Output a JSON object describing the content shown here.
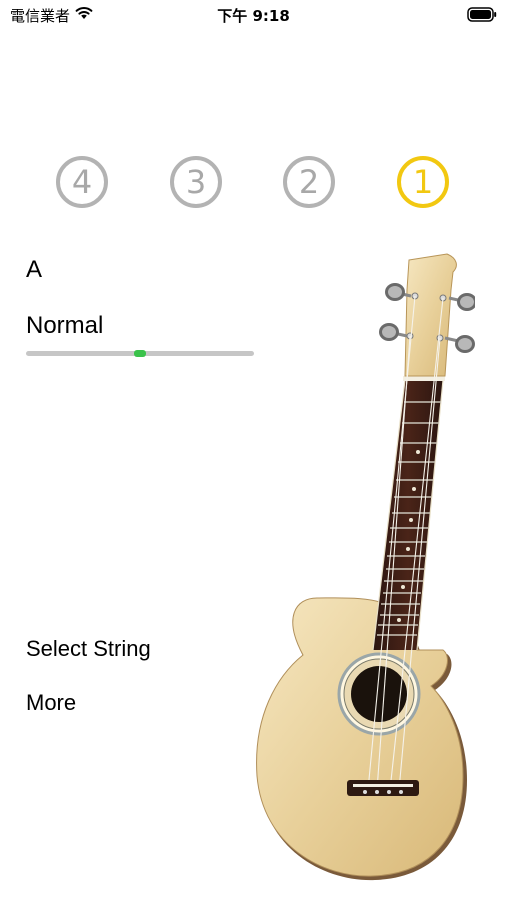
{
  "status_bar": {
    "carrier": "電信業者",
    "time": "下午 9:18"
  },
  "strings": [
    {
      "label": "4",
      "active": false
    },
    {
      "label": "3",
      "active": false
    },
    {
      "label": "2",
      "active": false
    },
    {
      "label": "1",
      "active": true
    }
  ],
  "tuner": {
    "note": "A",
    "status": "Normal",
    "meter_position": 0.5
  },
  "menu": {
    "select_string": "Select String",
    "more": "More"
  },
  "colors": {
    "active_ring": "#f2c811",
    "inactive_ring": "#b3b3b3",
    "meter_needle": "#3ac24a",
    "meter_track": "#c6c6c6"
  }
}
